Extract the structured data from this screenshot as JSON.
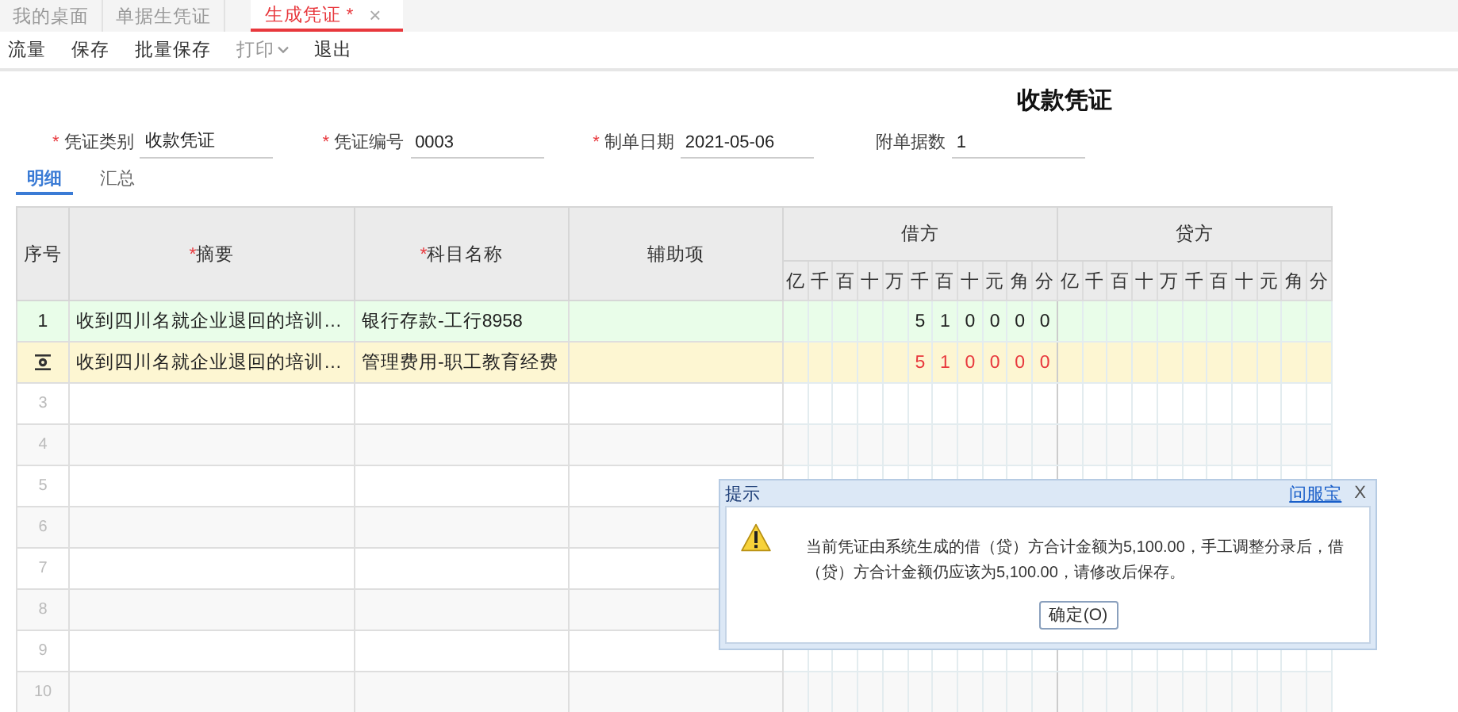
{
  "tabs": [
    {
      "label": "我的桌面",
      "selected": false
    },
    {
      "label": "单据生凭证",
      "selected": false
    },
    {
      "label": "生成凭证 *",
      "selected": true,
      "close": "×"
    }
  ],
  "toolbar": [
    {
      "label": "流量",
      "disabled": false
    },
    {
      "label": "保存",
      "disabled": false
    },
    {
      "label": "批量保存",
      "disabled": false
    },
    {
      "label": "打印",
      "disabled": true,
      "dropdown": true
    },
    {
      "label": "退出",
      "disabled": false
    }
  ],
  "voucher_title": "收款凭证",
  "fields": [
    {
      "mark": "*",
      "label": "凭证类别",
      "value": "收款凭证"
    },
    {
      "mark": "*",
      "label": "凭证编号",
      "value": "0003"
    },
    {
      "mark": "*",
      "label": "制单日期",
      "value": "2021-05-06"
    },
    {
      "label": "附单据数",
      "value": "1"
    }
  ],
  "detail_tabs": [
    {
      "label": "明细",
      "selected": true
    },
    {
      "label": "汇总",
      "selected": false
    }
  ],
  "table": {
    "columns": [
      {
        "label": "序号"
      },
      {
        "mark": "*",
        "label": "摘要"
      },
      {
        "mark": "*",
        "label": "科目名称"
      },
      {
        "label": "辅助项"
      }
    ],
    "debit_label": "借方",
    "credit_label": "贷方",
    "debit_units": [
      "亿",
      "千",
      "百",
      "十",
      "万",
      "千",
      "百",
      "十",
      "元",
      "角",
      "分"
    ],
    "credit_units": [
      "亿",
      "千",
      "百",
      "十",
      "万",
      "千",
      "百",
      "十",
      "元",
      "角",
      "分"
    ],
    "rows": [
      {
        "kind": "entry",
        "number": "1",
        "summary": "收到四川名就企业退回的培训…",
        "account": "银行存款-工行8958",
        "debit": [
          "5",
          "1",
          "0",
          "0",
          "0",
          "0"
        ]
      },
      {
        "kind": "active",
        "summary": "收到四川名就企业退回的培训…",
        "account": "管理费用-职工教育经费",
        "debit": [
          "5",
          "1",
          "0",
          "0",
          "0",
          "0"
        ]
      },
      {
        "kind": "blank",
        "number": "3"
      },
      {
        "kind": "blank",
        "number": "4"
      },
      {
        "kind": "blank",
        "number": "5"
      },
      {
        "kind": "blank",
        "number": "6"
      },
      {
        "kind": "blank",
        "number": "7"
      },
      {
        "kind": "blank",
        "number": "8"
      },
      {
        "kind": "blank",
        "number": "9"
      },
      {
        "kind": "blank",
        "number": "10"
      }
    ]
  },
  "dialog": {
    "title": "提示",
    "link": "问服宝",
    "close": "X",
    "message": "当前凭证由系统生成的借（贷）方合计金额为5,100.00，手工调整分录后，借（贷）方合计金额仍应该为5,100.00，请修改后保存。",
    "button": "确定(O)"
  }
}
